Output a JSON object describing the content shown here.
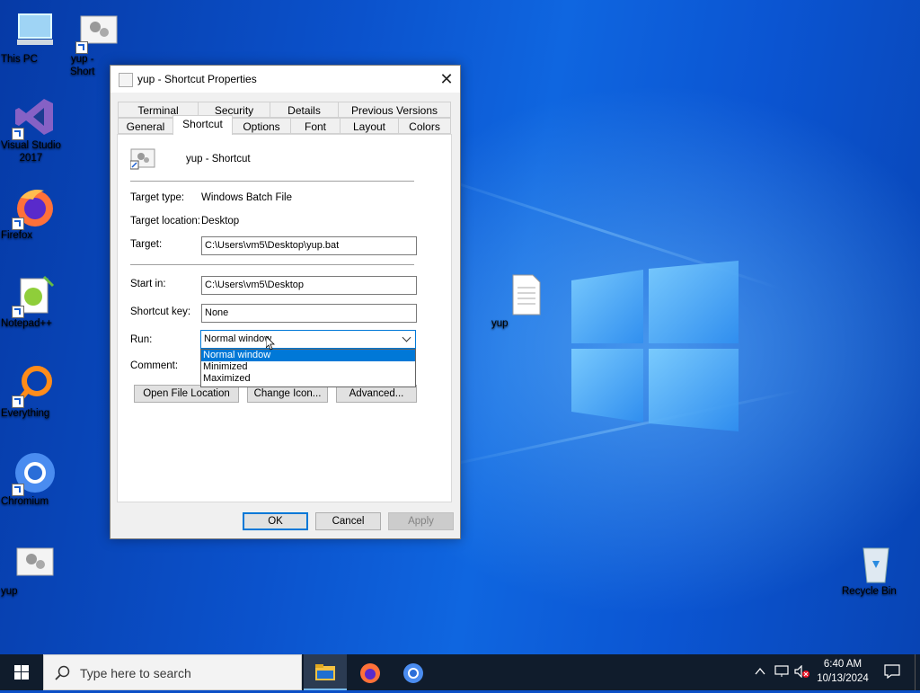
{
  "desktop": {
    "icons": [
      {
        "label": "This PC"
      },
      {
        "label": "yup -\nShort"
      },
      {
        "label": "Visual Studio\n2017"
      },
      {
        "label": "Firefox"
      },
      {
        "label": "Notepad++"
      },
      {
        "label": "Everything"
      },
      {
        "label": "Chromium"
      },
      {
        "label": "yup"
      },
      {
        "label": "yup"
      },
      {
        "label": "Recycle Bin"
      }
    ]
  },
  "dialog": {
    "title": "yup - Shortcut Properties",
    "tabs_row1": [
      "Terminal",
      "Security",
      "Details",
      "Previous Versions"
    ],
    "tabs_row2": [
      "General",
      "Shortcut",
      "Options",
      "Font",
      "Layout",
      "Colors"
    ],
    "active_tab": "Shortcut",
    "shortcut_name": "yup - Shortcut",
    "target_type_label": "Target type:",
    "target_type_value": "Windows Batch File",
    "target_location_label": "Target location:",
    "target_location_value": "Desktop",
    "target_label": "Target:",
    "target_value": "C:\\Users\\vm5\\Desktop\\yup.bat",
    "start_in_label": "Start in:",
    "start_in_value": "C:\\Users\\vm5\\Desktop",
    "shortcut_key_label": "Shortcut key:",
    "shortcut_key_value": "None",
    "run_label": "Run:",
    "run_value": "Normal window",
    "run_options": [
      "Normal window",
      "Minimized",
      "Maximized"
    ],
    "comment_label": "Comment:",
    "open_file_location": "Open File Location",
    "change_icon": "Change Icon...",
    "advanced": "Advanced...",
    "ok": "OK",
    "cancel": "Cancel",
    "apply": "Apply",
    "close_glyph": "✕"
  },
  "taskbar": {
    "search_placeholder": "Type here to search",
    "time": "6:40 AM",
    "date": "10/13/2024"
  },
  "colors": {
    "accent": "#0078d7",
    "taskbar": "#101c2c"
  }
}
